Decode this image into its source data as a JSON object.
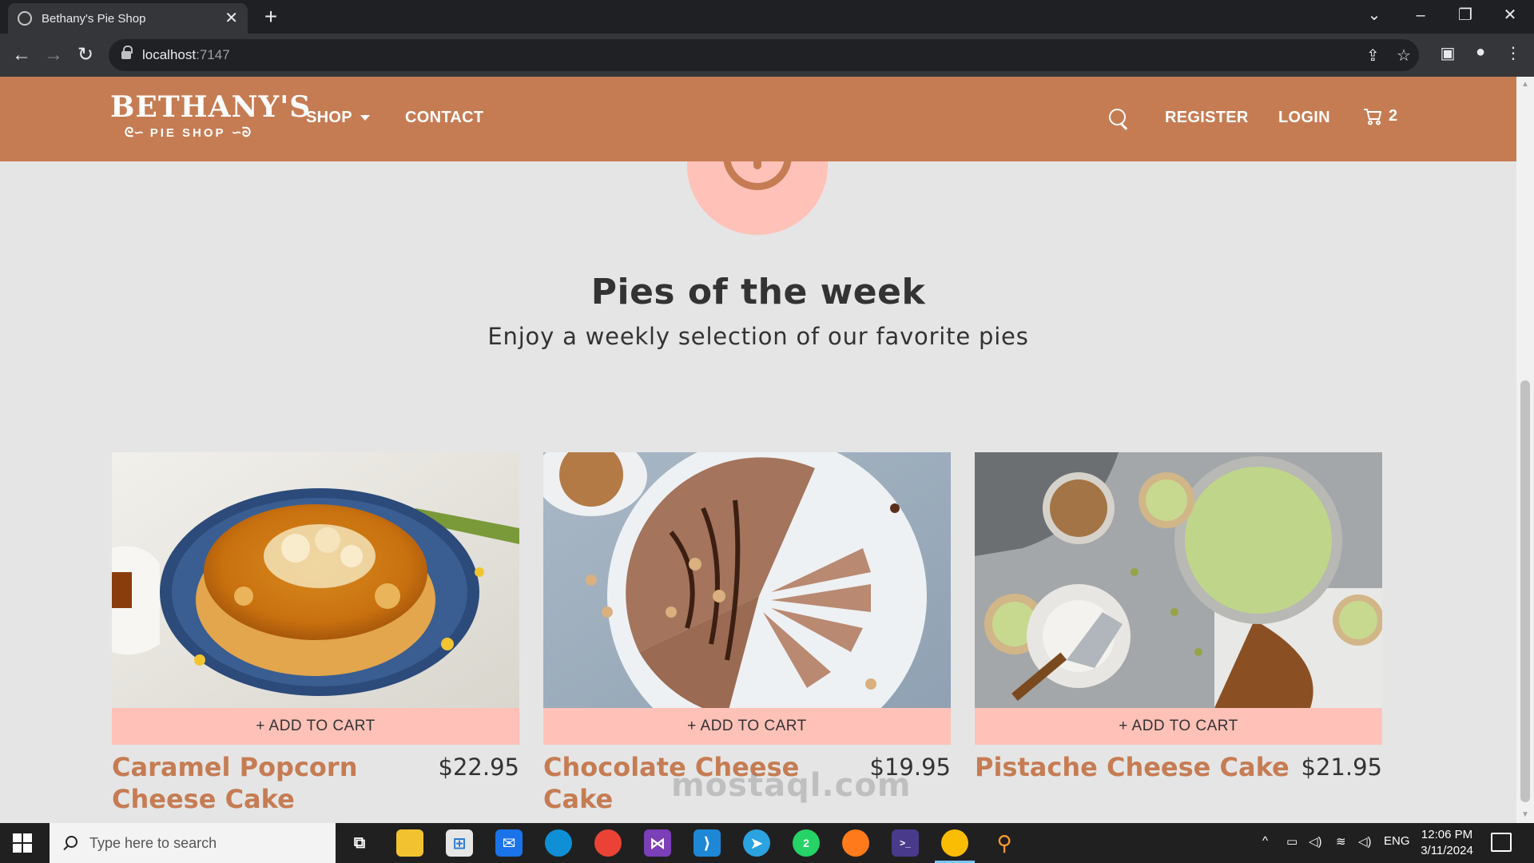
{
  "browser": {
    "tab_title": "Bethany's Pie Shop",
    "tab_close": "✕",
    "new_tab": "+",
    "url_host": "localhost",
    "url_port": ":7147"
  },
  "site": {
    "logo_main": "BETHANY'S",
    "logo_sub": "PIE SHOP",
    "nav": {
      "shop": "SHOP",
      "contact": "CONTACT",
      "register": "REGISTER",
      "login": "LOGIN",
      "cart_count": "2"
    }
  },
  "main": {
    "heading": "Pies of the week",
    "subheading": "Enjoy a weekly selection of our favorite pies",
    "add_to_cart_label": "+ ADD TO CART",
    "pies": [
      {
        "name": "Caramel Popcorn Cheese Cake",
        "price": "$22.95"
      },
      {
        "name": "Chocolate Cheese Cake",
        "price": "$19.95"
      },
      {
        "name": "Pistache Cheese Cake",
        "price": "$21.95"
      }
    ]
  },
  "watermark": "mostaql.com",
  "taskbar": {
    "search_placeholder": "Type here to search",
    "language": "ENG",
    "time": "12:06 PM",
    "date": "3/11/2024",
    "whatsapp_badge": "2"
  },
  "colors": {
    "brand": "#c67c53",
    "accent_pink": "#ffc1b8",
    "page_bg": "#e5e5e5"
  }
}
